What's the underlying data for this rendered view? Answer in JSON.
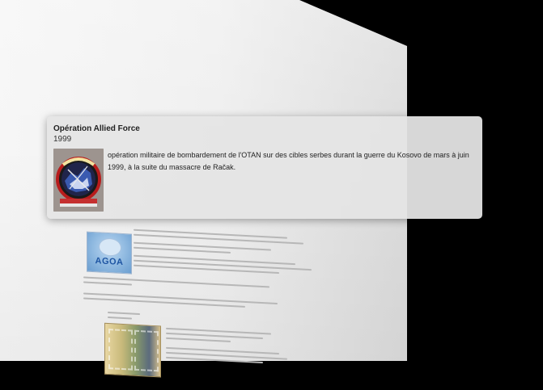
{
  "card": {
    "title": "Opération Allied Force",
    "subtitle": "1999",
    "description": "opération militaire de bombardement de l'OTAN sur des cibles serbes durant la guerre du Kosovo de mars à juin 1999, à la suite du massacre de Račak.",
    "image_icon": "allied-force-emblem-icon"
  },
  "document": {
    "logo_text": "AGOA",
    "colors": {
      "page": "#efefef",
      "background": "#000000",
      "card": "#e4e4e4",
      "agoa_blue": "#1f56a3"
    }
  }
}
